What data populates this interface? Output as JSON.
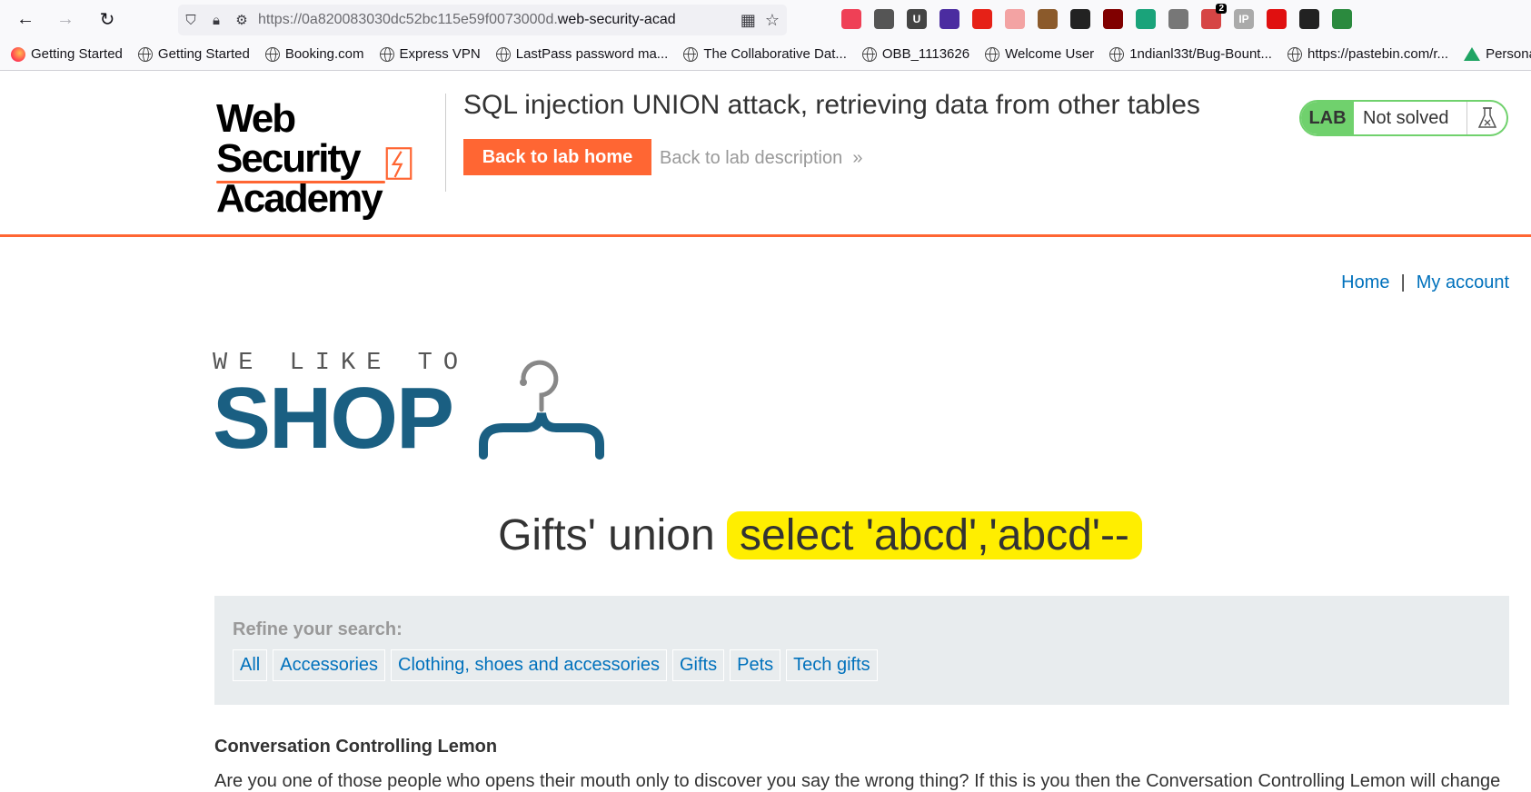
{
  "browser": {
    "url_prefix": "https://0a820083030dc52bc115e59f0073000d.",
    "url_domain": "web-security-acad",
    "extensions": [
      {
        "icon": "pocket-icon",
        "label": "",
        "color": "#ef4056"
      },
      {
        "icon": "download-icon",
        "label": "",
        "color": "#555555"
      },
      {
        "icon": "ublock-origin-u-icon",
        "label": "U",
        "color": "#444444"
      },
      {
        "icon": "purple-diamond-icon",
        "label": "",
        "color": "#4b2ca0"
      },
      {
        "icon": "red-play-icon",
        "label": "",
        "color": "#e62117"
      },
      {
        "icon": "pink-circles-icon",
        "label": "",
        "color": "#f3a3a3"
      },
      {
        "icon": "cookie-icon",
        "label": "",
        "color": "#8b5a2b"
      },
      {
        "icon": "spy-icon",
        "label": "",
        "color": "#222222"
      },
      {
        "icon": "ublock-shield-icon",
        "label": "",
        "color": "#800000"
      },
      {
        "icon": "green-mail-icon",
        "label": "",
        "color": "#1aa37a"
      },
      {
        "icon": "puzzle-icon",
        "label": "",
        "color": "#777777"
      },
      {
        "icon": "hack-tools-icon",
        "label": "",
        "color": "#d64545",
        "badge": "2"
      },
      {
        "icon": "ip-icon",
        "label": "IP",
        "color": "#aaaaaa"
      },
      {
        "icon": "stop-icon",
        "label": "",
        "color": "#e01010"
      },
      {
        "icon": "grid-plus-icon",
        "label": "",
        "color": "#222222"
      },
      {
        "icon": "download-manager-icon",
        "label": "",
        "color": "#2b8a3e"
      }
    ],
    "bookmarks": [
      {
        "label": "Getting Started",
        "icon": "firefox-icon"
      },
      {
        "label": "Getting Started",
        "icon": "globe-icon"
      },
      {
        "label": "Booking.com",
        "icon": "globe-icon"
      },
      {
        "label": "Express VPN",
        "icon": "globe-icon"
      },
      {
        "label": "LastPass password ma...",
        "icon": "globe-icon"
      },
      {
        "label": "The Collaborative Dat...",
        "icon": "globe-icon"
      },
      {
        "label": "OBB_1113626",
        "icon": "globe-icon"
      },
      {
        "label": "Welcome User",
        "icon": "globe-icon"
      },
      {
        "label": "1ndianl33t/Bug-Bount...",
        "icon": "globe-icon"
      },
      {
        "label": "https://pastebin.com/r...",
        "icon": "globe-icon"
      },
      {
        "label": "Persona",
        "icon": "drive-icon"
      }
    ]
  },
  "lab": {
    "logo_line1": "Web Security",
    "logo_line2": "Academy",
    "title": "SQL injection UNION attack, retrieving data from other tables",
    "back_home": "Back to lab home",
    "back_desc": "Back to lab description",
    "tag": "LAB",
    "status": "Not solved",
    "accent": "#ff6633",
    "status_color": "#70d16d"
  },
  "page": {
    "nav": {
      "home": "Home",
      "sep": "|",
      "account": "My account"
    },
    "logo_tagline": "WE LIKE TO",
    "logo_word": "SHOP",
    "heading_plain": "Gifts' union",
    "heading_highlight": "select 'abcd','abcd'--",
    "filter_label": "Refine your search:",
    "filters": [
      "All",
      "Accessories",
      "Clothing, shoes and accessories",
      "Gifts",
      "Pets",
      "Tech gifts"
    ],
    "product_name": "Conversation Controlling Lemon",
    "product_desc": "Are you one of those people who opens their mouth only to discover you say the wrong thing? If this is you then the Conversation Controlling Lemon will change"
  }
}
